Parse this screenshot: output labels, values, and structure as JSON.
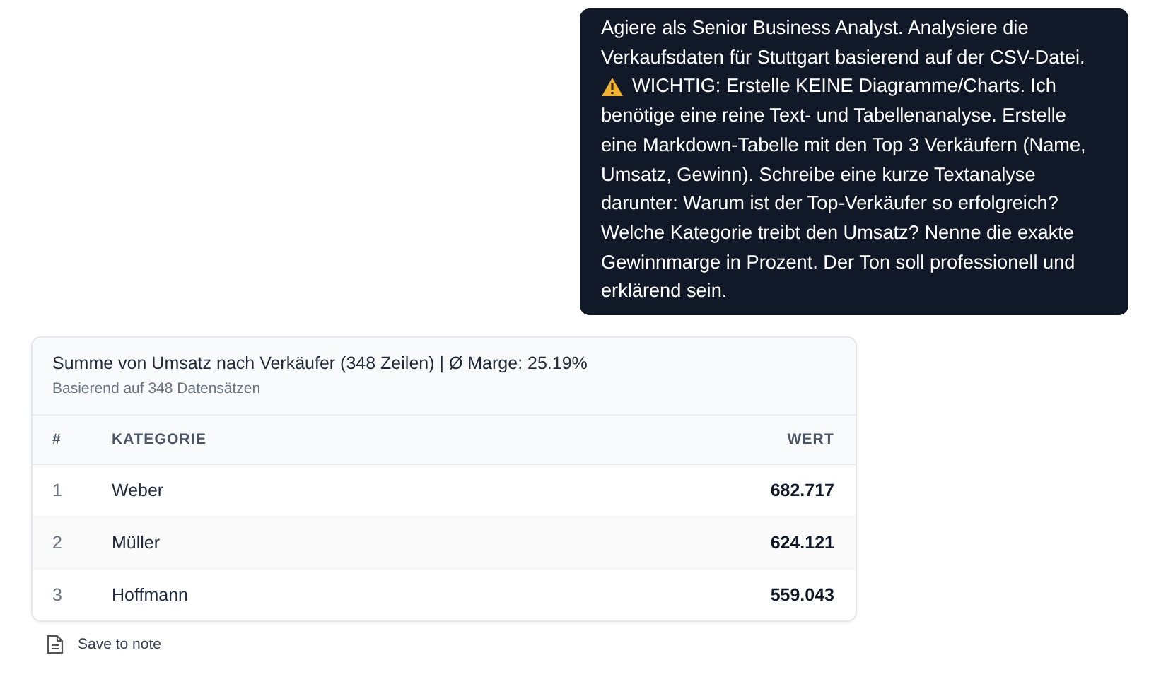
{
  "message": {
    "text_before": "Agiere als Senior Business Analyst. Analysiere die Verkaufsdaten für Stuttgart basierend auf der CSV-Datei.",
    "warning_line": "WICHTIG: Erstelle KEINE Diagramme/Charts. Ich",
    "text_after": "benötige eine reine Text- und Tabellenanalyse. Erstelle eine Markdown-Tabelle mit den Top 3 Verkäufern (Name, Umsatz, Gewinn). Schreibe eine kurze Textanalyse darunter: Warum ist der Top-Verkäufer so erfolgreich? Welche Kategorie treibt den Umsatz? Nenne die exakte Gewinnmarge in Prozent. Der Ton soll professionell und erklärend sein."
  },
  "result": {
    "title": "Summe von Umsatz nach Verkäufer (348 Zeilen) | Ø Marge: 25.19%",
    "subtitle": "Basierend auf 348 Datensätzen",
    "columns": [
      "#",
      "KATEGORIE",
      "WERT"
    ],
    "rows": [
      {
        "rank": "1",
        "name": "Weber",
        "value": "682.717"
      },
      {
        "rank": "2",
        "name": "Müller",
        "value": "624.121"
      },
      {
        "rank": "3",
        "name": "Hoffmann",
        "value": "559.043"
      }
    ]
  },
  "save_action": {
    "label": "Save to note"
  }
}
